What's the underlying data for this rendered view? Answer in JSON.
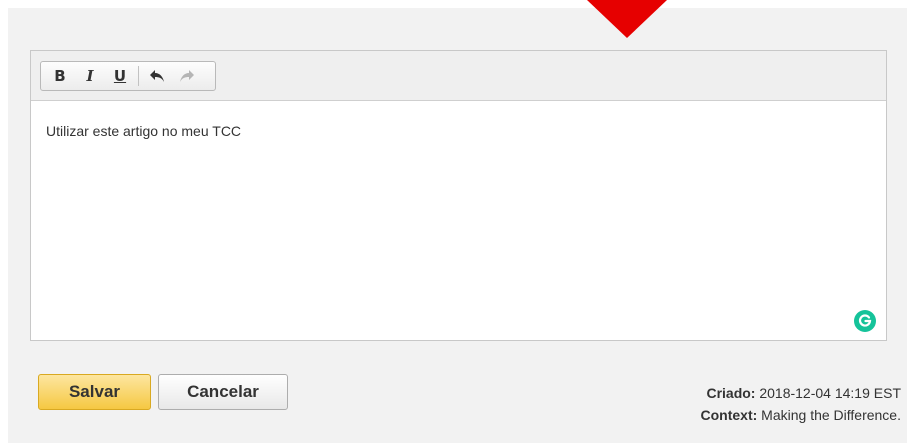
{
  "editor": {
    "toolbar": {
      "bold": "B",
      "italic": "I",
      "underline": "U"
    },
    "content": "Utilizar este artigo no meu TCC"
  },
  "actions": {
    "save_label": "Salvar",
    "cancel_label": "Cancelar"
  },
  "meta": {
    "created_label": "Criado:",
    "created_value": "2018-12-04 14:19 EST",
    "context_label": "Context:",
    "context_value": "Making the Difference."
  },
  "colors": {
    "pointer": "#e60000",
    "save_button": "#f5c842",
    "grammarly": "#15c39a"
  },
  "icons": {
    "undo": "undo-arrow",
    "redo": "redo-arrow",
    "grammarly": "grammarly-g"
  }
}
